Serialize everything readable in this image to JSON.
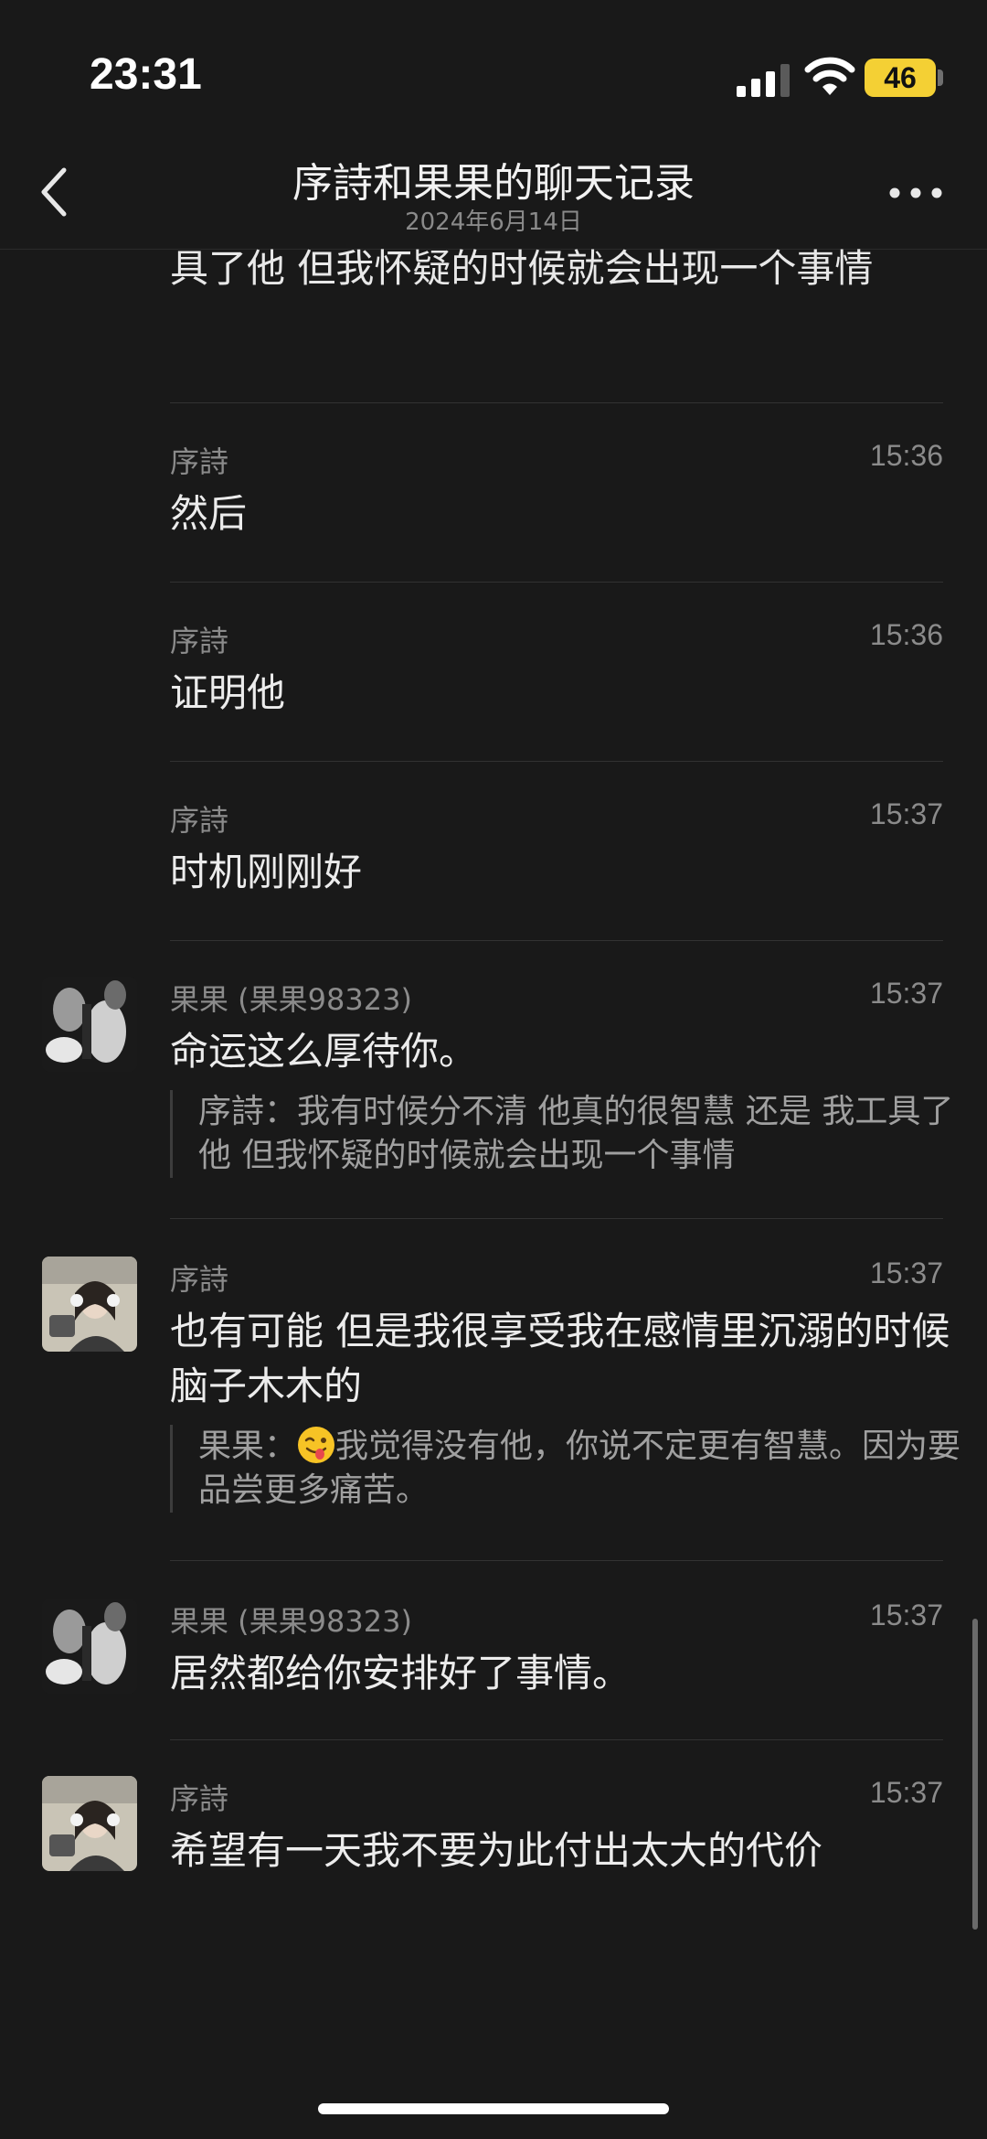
{
  "status_bar": {
    "time": "23:31",
    "battery": "46"
  },
  "nav": {
    "title": "序詩和果果的聊天记录",
    "date": "2024年6月14日"
  },
  "continued_message": {
    "text": "具了他 但我怀疑的时候就会出现一个事情"
  },
  "messages": [
    {
      "sender": "序詩",
      "time": "15:36",
      "text": "然后",
      "avatar": "none"
    },
    {
      "sender": "序詩",
      "time": "15:36",
      "text": "证明他",
      "avatar": "none"
    },
    {
      "sender": "序詩",
      "time": "15:37",
      "text": "时机刚刚好",
      "avatar": "none"
    },
    {
      "sender": "果果 (果果98323)",
      "time": "15:37",
      "text": "命运这么厚待你。",
      "avatar": "sculpture-photo",
      "quote": "序詩：我有时候分不清 他真的很智慧 还是 我工具了他 但我怀疑的时候就会出现一个事情"
    },
    {
      "sender": "序詩",
      "time": "15:37",
      "text": "也有可能 但是我很享受我在感情里沉溺的时候 脑子木木的",
      "avatar": "girl-headphones-photo",
      "quote_prefix": "果果：",
      "quote_emoji": "winking-tongue-emoji",
      "quote_rest": "我觉得没有他，你说不定更有智慧。因为要品尝更多痛苦。"
    },
    {
      "sender": "果果 (果果98323)",
      "time": "15:37",
      "text": "居然都给你安排好了事情。",
      "avatar": "sculpture-photo"
    },
    {
      "sender": "序詩",
      "time": "15:37",
      "text": "希望有一天我不要为此付出太大的代价",
      "avatar": "girl-headphones-photo"
    }
  ],
  "icons": [
    "back-chevron-icon",
    "more-icon",
    "signal-icon",
    "wifi-icon",
    "battery-icon"
  ]
}
